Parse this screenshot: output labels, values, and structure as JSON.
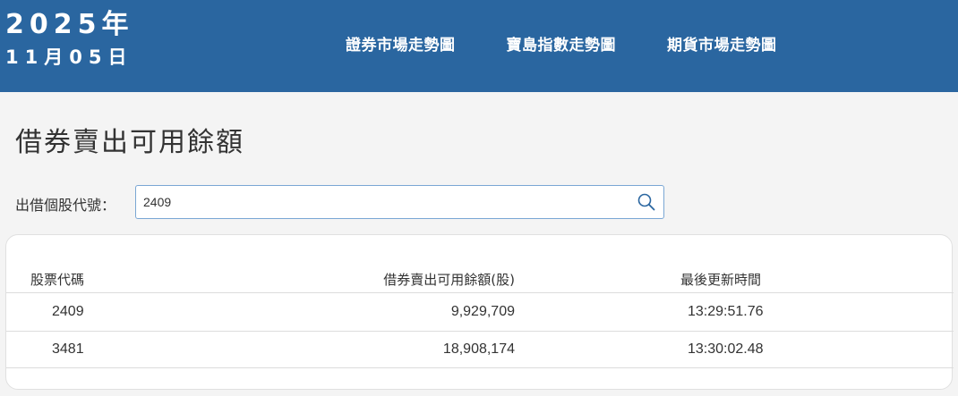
{
  "header": {
    "year": "2025年",
    "day": "11月05日",
    "nav": [
      {
        "label": "證券市場走勢圖"
      },
      {
        "label": "寶島指數走勢圖"
      },
      {
        "label": "期貨市場走勢圖"
      }
    ],
    "background_color": "#2a66a0"
  },
  "page": {
    "title": "借券賣出可用餘額"
  },
  "search": {
    "label": "出借個股代號：",
    "value": "2409",
    "icon": "search-icon"
  },
  "table": {
    "headers": [
      "股票代碼",
      "借券賣出可用餘額(股)",
      "最後更新時間"
    ],
    "rows": [
      {
        "code": "2409",
        "amount": "9,929,709",
        "time": "13:29:51.76"
      },
      {
        "code": "3481",
        "amount": "18,908,174",
        "time": "13:30:02.48"
      }
    ],
    "link_color": "#2a66a0"
  }
}
